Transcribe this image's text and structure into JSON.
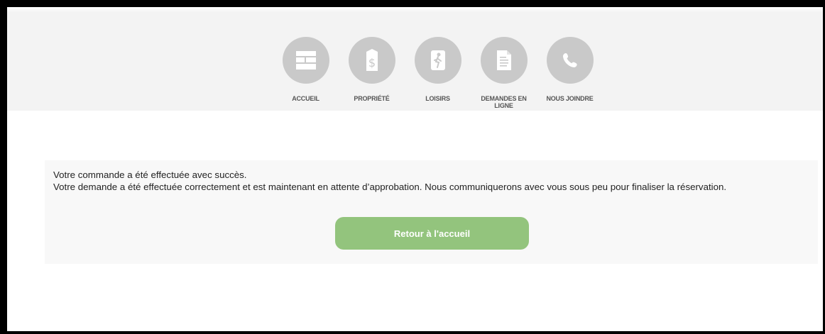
{
  "nav": {
    "items": [
      {
        "label": "ACCUEIL",
        "icon": "layout-icon"
      },
      {
        "label": "PROPRIÉTÉ",
        "icon": "property-tax-icon"
      },
      {
        "label": "LOISIRS",
        "icon": "leisure-icon"
      },
      {
        "label": "DEMANDES EN LIGNE",
        "icon": "document-icon"
      },
      {
        "label": "NOUS JOINDRE",
        "icon": "phone-icon"
      }
    ]
  },
  "message": {
    "line1": "Votre commande a été effectuée avec succès.",
    "line2": "Votre demande a été effectuée correctement et est maintenant en attente d’approbation. Nous communiquerons avec vous sous peu pour finaliser la réservation."
  },
  "button": {
    "label": "Retour à l'accueil"
  },
  "colors": {
    "icon_circle": "#c9c9c9",
    "button": "#93c47d",
    "header_bg": "#f3f3f3"
  }
}
